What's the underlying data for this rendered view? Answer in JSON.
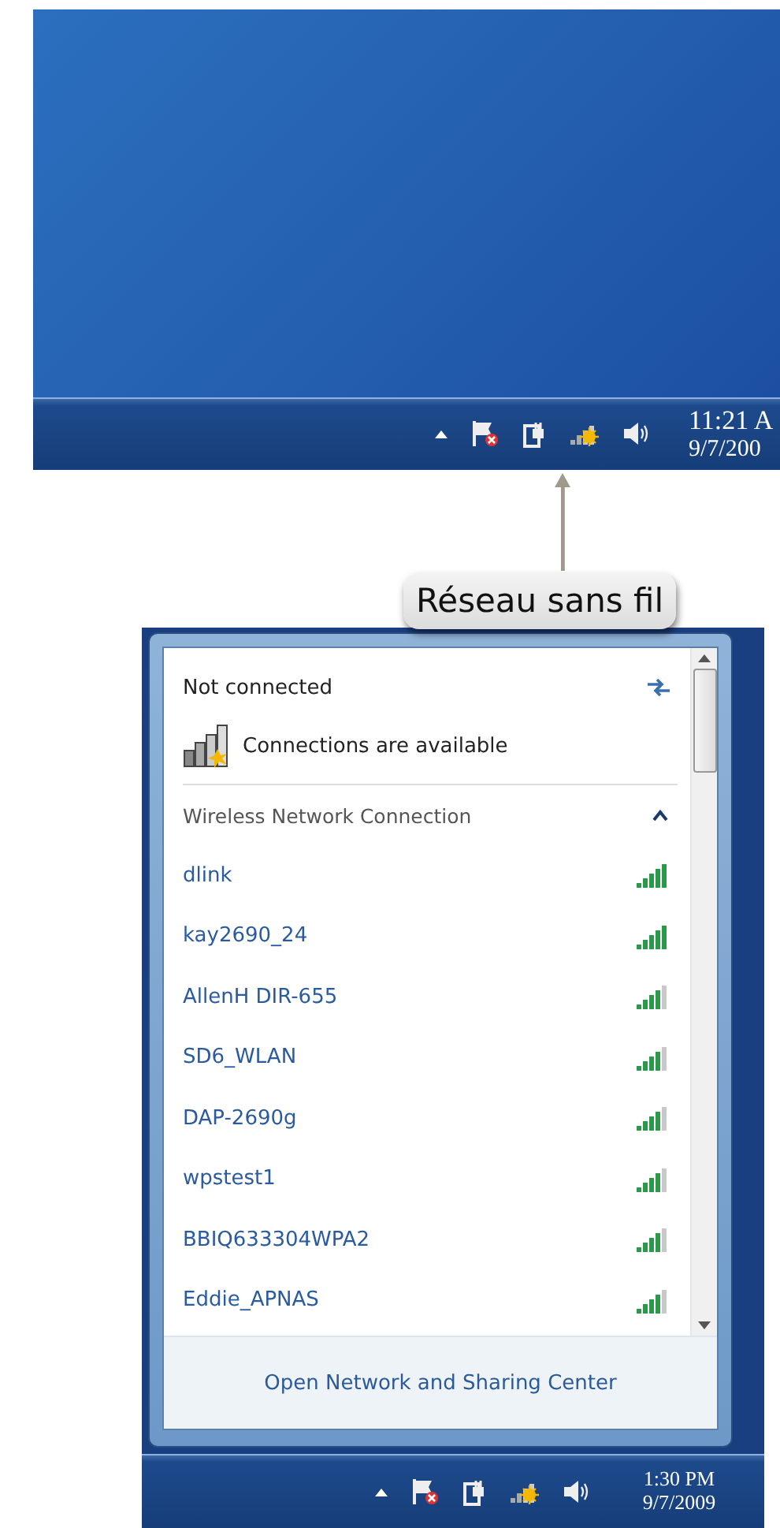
{
  "top_screenshot": {
    "clock": {
      "time": "11:21 A",
      "date": "9/7/200"
    }
  },
  "callout": {
    "text": "Réseau sans fil"
  },
  "network_panel": {
    "status": "Not connected",
    "availability": "Connections are available",
    "section": {
      "title": "Wireless Network Connection",
      "expanded": true
    },
    "networks": [
      {
        "name": "dlink",
        "level": 1
      },
      {
        "name": "kay2690_24",
        "level": 1
      },
      {
        "name": "AllenH DIR-655",
        "level": 0.8
      },
      {
        "name": "SD6_WLAN",
        "level": 0.8
      },
      {
        "name": "DAP-2690g",
        "level": 0.8
      },
      {
        "name": "wpstest1",
        "level": 0.8
      },
      {
        "name": "BBIQ633304WPA2",
        "level": 0.8
      },
      {
        "name": "Eddie_APNAS",
        "level": 0.8
      }
    ],
    "footer_link": "Open Network and Sharing Center"
  },
  "bottom_taskbar": {
    "clock": {
      "time": "1:30 PM",
      "date": "9/7/2009"
    }
  }
}
